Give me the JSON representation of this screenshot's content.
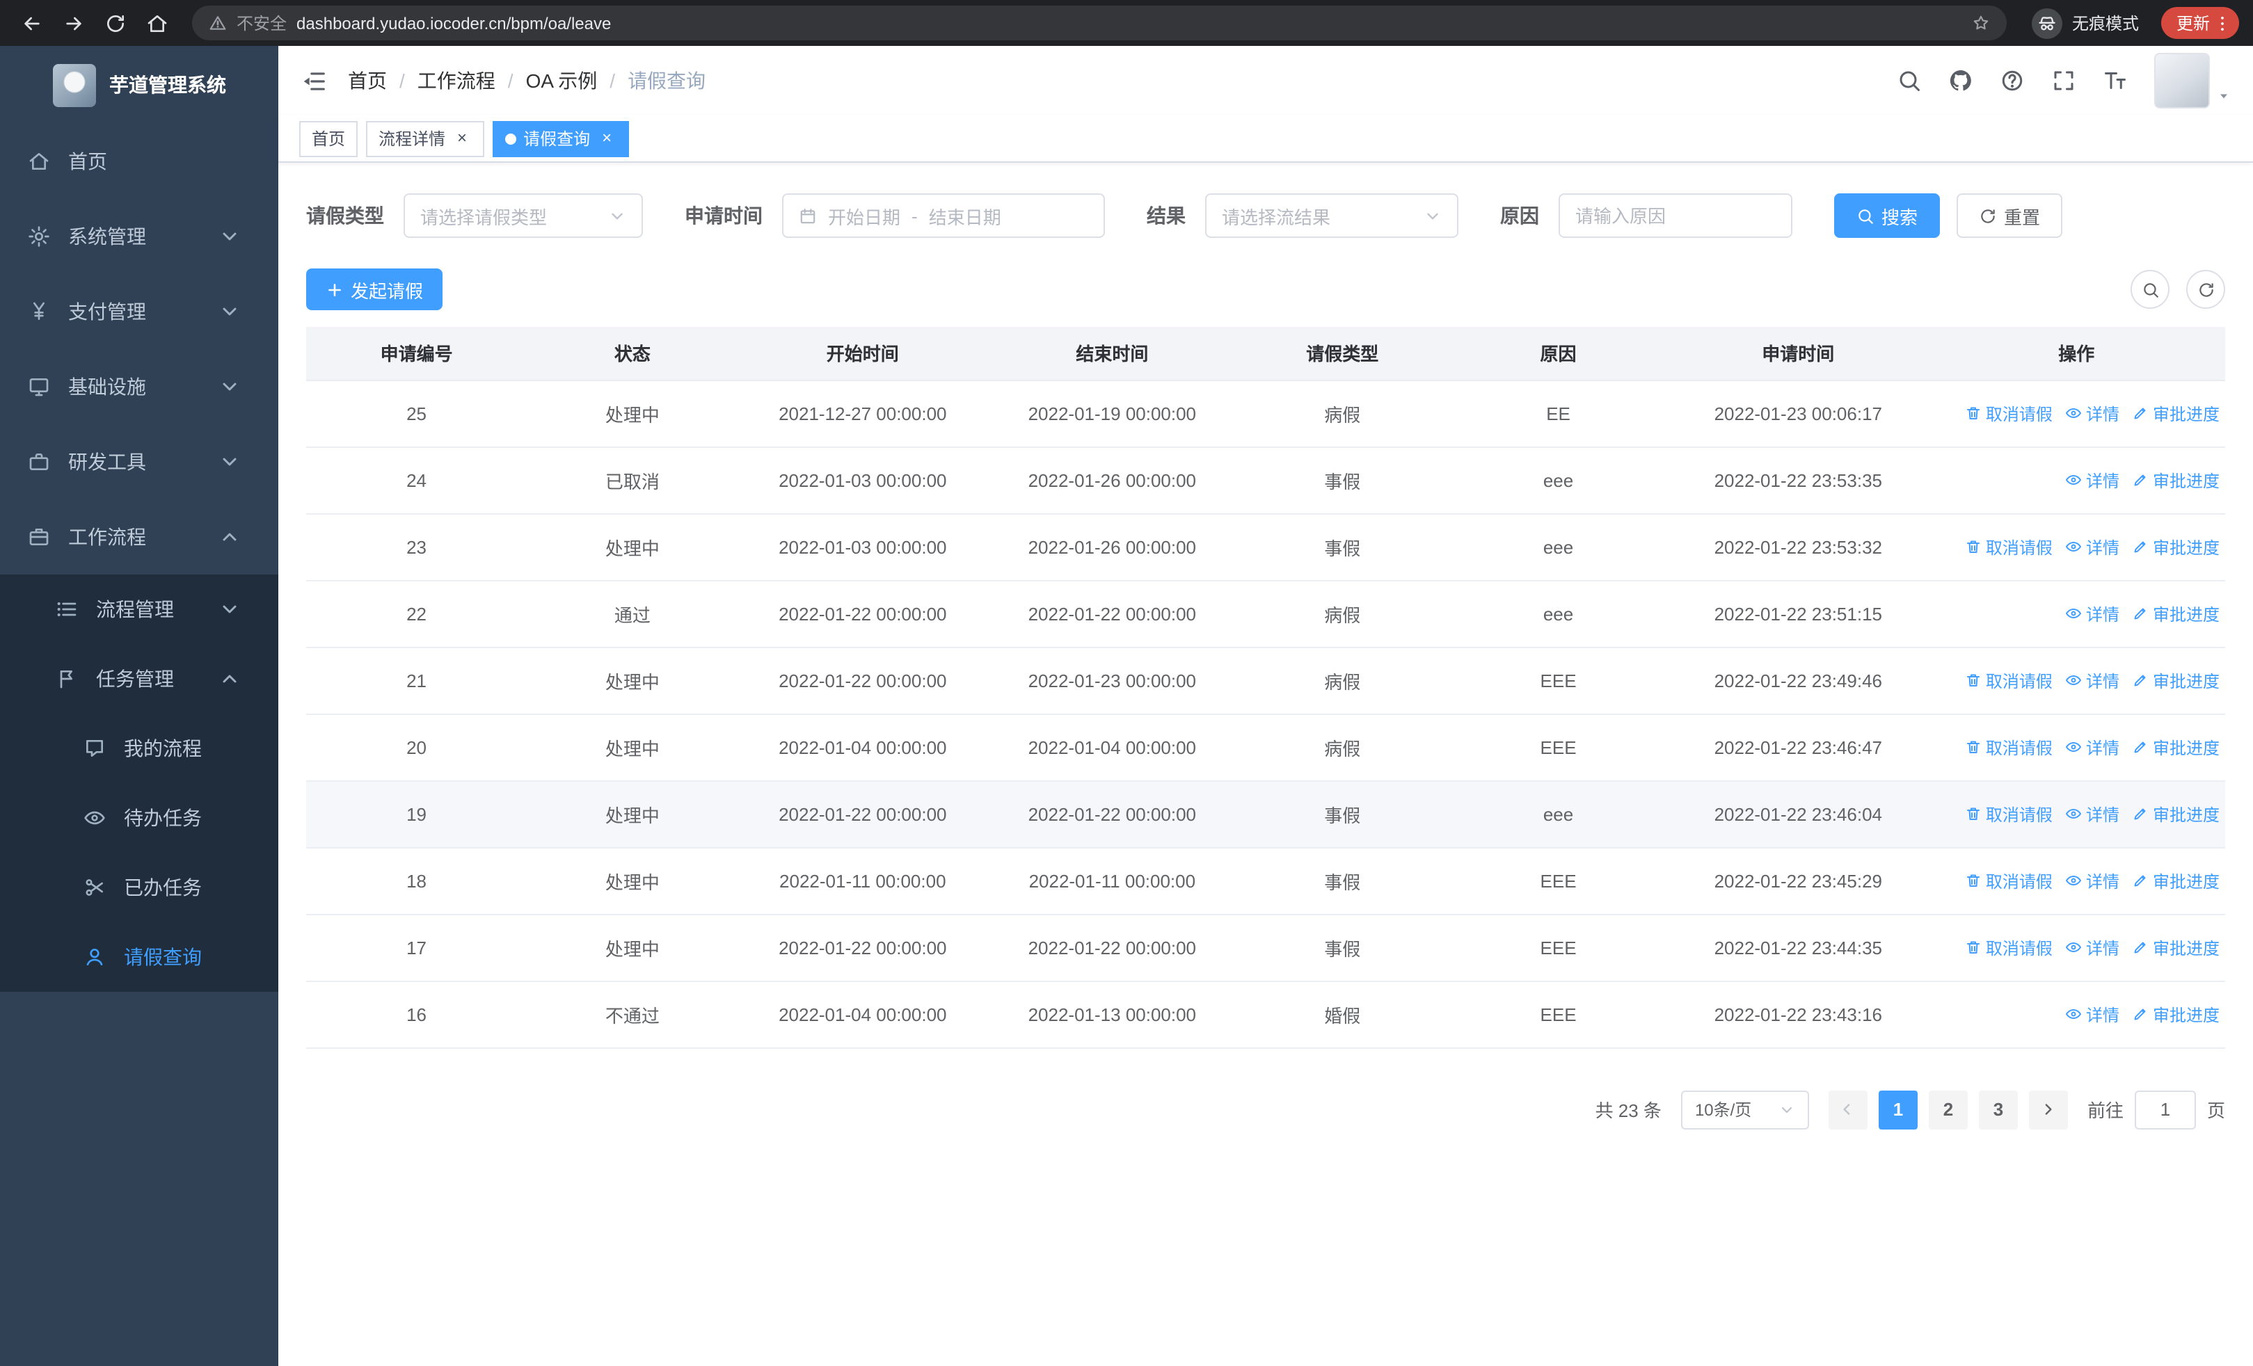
{
  "browser": {
    "security_label": "不安全",
    "url": "dashboard.yudao.iocoder.cn/bpm/oa/leave",
    "incognito_label": "无痕模式",
    "update_label": "更新"
  },
  "sidebar": {
    "title": "芋道管理系统",
    "top_items": [
      {
        "key": "home",
        "label": "首页",
        "icon": "home-icon",
        "expandable": false,
        "expanded": false,
        "active": false
      },
      {
        "key": "system",
        "label": "系统管理",
        "icon": "gear-icon",
        "expandable": true,
        "expanded": false,
        "active": false
      },
      {
        "key": "payment",
        "label": "支付管理",
        "icon": "yen-icon",
        "expandable": true,
        "expanded": false,
        "active": false
      },
      {
        "key": "infra",
        "label": "基础设施",
        "icon": "infra-icon",
        "expandable": true,
        "expanded": false,
        "active": false
      },
      {
        "key": "devtools",
        "label": "研发工具",
        "icon": "tools-icon",
        "expandable": true,
        "expanded": false,
        "active": false
      },
      {
        "key": "workflow",
        "label": "工作流程",
        "icon": "workflow-icon",
        "expandable": true,
        "expanded": true,
        "active": false
      }
    ],
    "workflow_children": [
      {
        "key": "process-mgmt",
        "label": "流程管理",
        "icon": "process-icon",
        "expandable": true,
        "expanded": false,
        "active": false
      },
      {
        "key": "task-mgmt",
        "label": "任务管理",
        "icon": "task-icon",
        "expandable": true,
        "expanded": true,
        "active": false
      }
    ],
    "task_children": [
      {
        "key": "my-process",
        "label": "我的流程",
        "icon": "chat-icon",
        "active": false
      },
      {
        "key": "todo-tasks",
        "label": "待办任务",
        "icon": "eye-icon",
        "active": false
      },
      {
        "key": "done-tasks",
        "label": "已办任务",
        "icon": "done-icon",
        "active": false
      },
      {
        "key": "leave-query",
        "label": "请假查询",
        "icon": "user-icon",
        "active": true
      }
    ]
  },
  "header": {
    "breadcrumb": [
      "首页",
      "工作流程",
      "OA 示例",
      "请假查询"
    ],
    "separator": "/",
    "icons": [
      "search-icon",
      "github-icon",
      "help-icon",
      "fullscreen-icon",
      "fontsize-icon"
    ]
  },
  "tabs": [
    {
      "key": "home",
      "label": "首页",
      "closable": false,
      "active": false
    },
    {
      "key": "process-detail",
      "label": "流程详情",
      "closable": true,
      "active": false
    },
    {
      "key": "leave-query",
      "label": "请假查询",
      "closable": true,
      "active": true
    }
  ],
  "ui": {
    "close_glyph": "×"
  },
  "filters": {
    "leave_type_label": "请假类型",
    "leave_type_placeholder": "请选择请假类型",
    "apply_time_label": "申请时间",
    "start_date_placeholder": "开始日期",
    "range_separator": "-",
    "end_date_placeholder": "结束日期",
    "result_label": "结果",
    "result_placeholder": "请选择流结果",
    "reason_label": "原因",
    "reason_placeholder": "请输入原因",
    "search_label": "搜索",
    "reset_label": "重置"
  },
  "toolbar": {
    "create_label": "发起请假",
    "icons": [
      "search-icon",
      "refresh-icon"
    ]
  },
  "table": {
    "columns": [
      "申请编号",
      "状态",
      "开始时间",
      "结束时间",
      "请假类型",
      "原因",
      "申请时间",
      "操作"
    ],
    "action_labels": {
      "cancel": "取消请假",
      "detail": "详情",
      "progress": "审批进度"
    },
    "rows": [
      {
        "id": "25",
        "status": "处理中",
        "start": "2021-12-27 00:00:00",
        "end": "2022-01-19 00:00:00",
        "type": "病假",
        "reason": "EE",
        "applied": "2022-01-23 00:06:17",
        "cancellable": true,
        "highlighted": false
      },
      {
        "id": "24",
        "status": "已取消",
        "start": "2022-01-03 00:00:00",
        "end": "2022-01-26 00:00:00",
        "type": "事假",
        "reason": "eee",
        "applied": "2022-01-22 23:53:35",
        "cancellable": false,
        "highlighted": false
      },
      {
        "id": "23",
        "status": "处理中",
        "start": "2022-01-03 00:00:00",
        "end": "2022-01-26 00:00:00",
        "type": "事假",
        "reason": "eee",
        "applied": "2022-01-22 23:53:32",
        "cancellable": true,
        "highlighted": false
      },
      {
        "id": "22",
        "status": "通过",
        "start": "2022-01-22 00:00:00",
        "end": "2022-01-22 00:00:00",
        "type": "病假",
        "reason": "eee",
        "applied": "2022-01-22 23:51:15",
        "cancellable": false,
        "highlighted": false
      },
      {
        "id": "21",
        "status": "处理中",
        "start": "2022-01-22 00:00:00",
        "end": "2022-01-23 00:00:00",
        "type": "病假",
        "reason": "EEE",
        "applied": "2022-01-22 23:49:46",
        "cancellable": true,
        "highlighted": false
      },
      {
        "id": "20",
        "status": "处理中",
        "start": "2022-01-04 00:00:00",
        "end": "2022-01-04 00:00:00",
        "type": "病假",
        "reason": "EEE",
        "applied": "2022-01-22 23:46:47",
        "cancellable": true,
        "highlighted": false
      },
      {
        "id": "19",
        "status": "处理中",
        "start": "2022-01-22 00:00:00",
        "end": "2022-01-22 00:00:00",
        "type": "事假",
        "reason": "eee",
        "applied": "2022-01-22 23:46:04",
        "cancellable": true,
        "highlighted": true
      },
      {
        "id": "18",
        "status": "处理中",
        "start": "2022-01-11 00:00:00",
        "end": "2022-01-11 00:00:00",
        "type": "事假",
        "reason": "EEE",
        "applied": "2022-01-22 23:45:29",
        "cancellable": true,
        "highlighted": false
      },
      {
        "id": "17",
        "status": "处理中",
        "start": "2022-01-22 00:00:00",
        "end": "2022-01-22 00:00:00",
        "type": "事假",
        "reason": "EEE",
        "applied": "2022-01-22 23:44:35",
        "cancellable": true,
        "highlighted": false
      },
      {
        "id": "16",
        "status": "不通过",
        "start": "2022-01-04 00:00:00",
        "end": "2022-01-13 00:00:00",
        "type": "婚假",
        "reason": "EEE",
        "applied": "2022-01-22 23:43:16",
        "cancellable": false,
        "highlighted": false
      }
    ]
  },
  "pagination": {
    "total_label": "共 23 条",
    "page_size": "10条/页",
    "pages": [
      "1",
      "2",
      "3"
    ],
    "active_page": "1",
    "goto_label": "前往",
    "goto_value": "1",
    "page_unit": "页"
  },
  "colors": {
    "primary": "#409eff",
    "sidebar_bg": "#304156",
    "sidebar_submenu_bg": "#1f2d3d",
    "sidebar_text": "#bfcbd9",
    "link": "#409eff",
    "update_pill": "#d6493f"
  }
}
